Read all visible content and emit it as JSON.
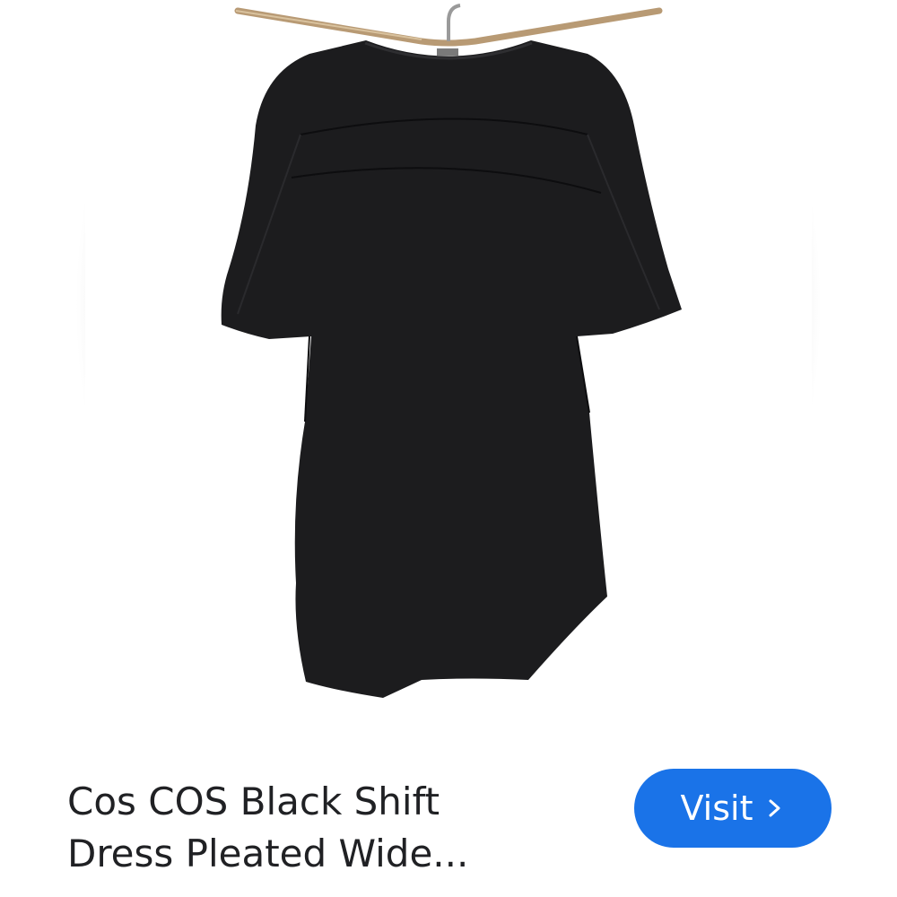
{
  "product": {
    "title_line1": "Cos COS Black Shift",
    "title_line2": "Dress Pleated Wide...",
    "image_alt": "Black shift dress on hanger"
  },
  "actions": {
    "visit_label": "Visit",
    "visit_icon": "chevron-right-icon"
  },
  "colors": {
    "button": "#1a73e8",
    "button_text": "#ffffff",
    "title_text": "#202124",
    "dress": "#1e1e1e"
  }
}
